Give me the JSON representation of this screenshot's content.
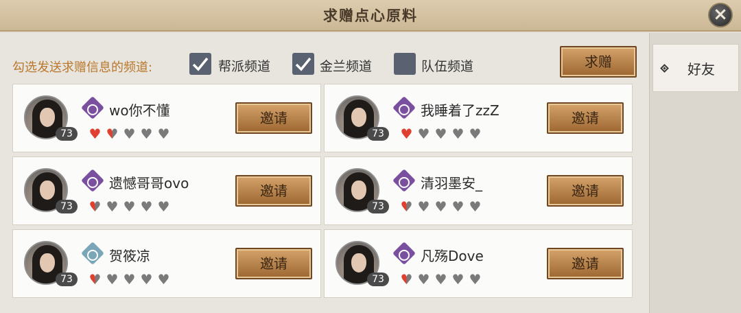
{
  "header": {
    "title": "求赠点心原料",
    "close_icon": "close-icon"
  },
  "channels": {
    "label": "勾选发送求赠信息的频道:",
    "options": [
      {
        "label": "帮派频道",
        "checked": true
      },
      {
        "label": "金兰频道",
        "checked": true
      },
      {
        "label": "队伍频道",
        "checked": false
      }
    ]
  },
  "request_button": "求赠",
  "side_tabs": [
    {
      "label": "好友",
      "icon": "diamond-icon",
      "active": true
    }
  ],
  "colors": {
    "accent_gold": "#b9782c",
    "heart_red": "#e0402f",
    "heart_gray": "#7a7a7a",
    "emblem_purple": "#7a4fa0",
    "emblem_teal": "#7aa6b8"
  },
  "friends": [
    {
      "name": "wo你不懂",
      "level": "73",
      "emblem": "purple-fan-emblem",
      "hearts": 1.5,
      "invite": "邀请"
    },
    {
      "name": "我睡着了zzZ",
      "level": "73",
      "emblem": "purple-fan-emblem",
      "hearts": 1,
      "invite": "邀请"
    },
    {
      "name": "遗憾哥哥ovo",
      "level": "73",
      "emblem": "purple-fan-emblem",
      "hearts": 0.5,
      "invite": "邀请"
    },
    {
      "name": "清羽墨安_",
      "level": "73",
      "emblem": "purple-fan-emblem",
      "hearts": 0.5,
      "invite": "邀请"
    },
    {
      "name": "贺筱凉",
      "level": "73",
      "emblem": "teal-feather-emblem",
      "hearts": 0.5,
      "invite": "邀请"
    },
    {
      "name": "凡殇Dove",
      "level": "73",
      "emblem": "purple-fan-emblem",
      "hearts": 0.5,
      "invite": "邀请"
    }
  ]
}
